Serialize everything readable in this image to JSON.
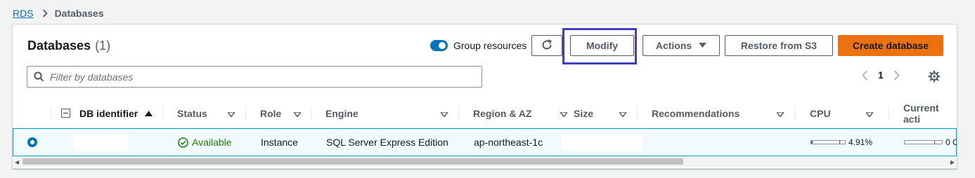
{
  "breadcrumb": {
    "root": "RDS",
    "current": "Databases"
  },
  "panel": {
    "title": "Databases",
    "count": "(1)",
    "group_resources_label": "Group resources",
    "group_resources_on": true,
    "buttons": {
      "modify": "Modify",
      "actions": "Actions",
      "restore": "Restore from S3",
      "create": "Create database"
    },
    "search_placeholder": "Filter by databases",
    "page_number": "1"
  },
  "columns": [
    "DB identifier",
    "Status",
    "Role",
    "Engine",
    "Region & AZ",
    "Size",
    "Recommendations",
    "CPU",
    "Current acti"
  ],
  "rows": [
    {
      "db_identifier": "",
      "status": "Available",
      "role": "Instance",
      "engine": "SQL Server Express Edition",
      "region_az": "ap-northeast-1c",
      "size": "",
      "recommendations": "",
      "cpu": "4.91%",
      "cpu_fraction": 0.0491,
      "current_activity": "0 Co"
    }
  ],
  "colors": {
    "accent": "#0073bb",
    "primary_button": "#ec7211",
    "status_ok": "#1d8102",
    "highlight": "#3f3fbf"
  }
}
